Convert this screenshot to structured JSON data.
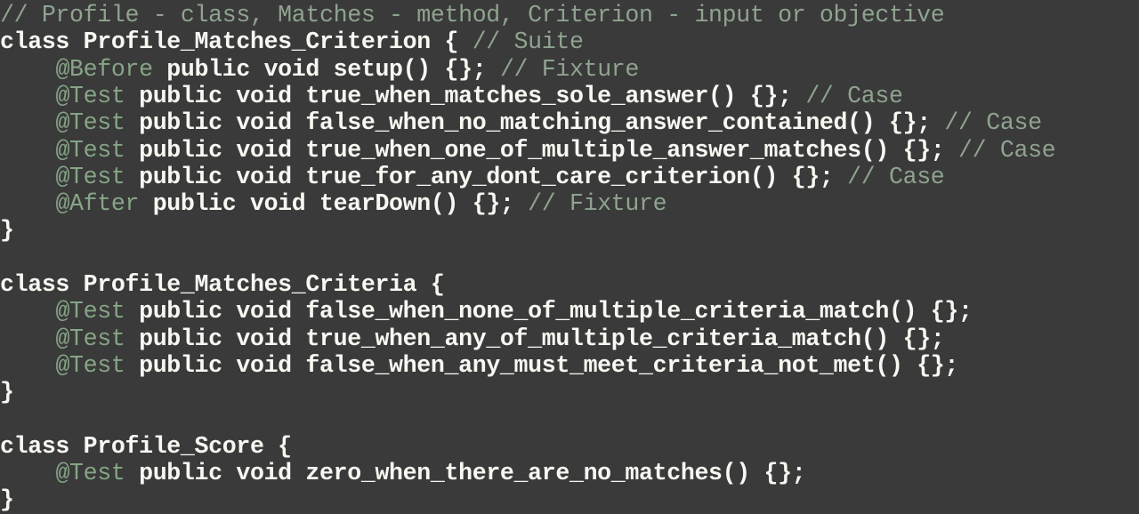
{
  "editor": {
    "colors": {
      "background": "#3a3a3a",
      "text": "#f8f8f2",
      "comment": "#8fa38f",
      "annotation": "#86a586"
    },
    "lines": [
      [
        {
          "t": "// Profile - class, Matches - method, Criterion - input or objective",
          "k": "comment"
        }
      ],
      [
        {
          "t": "class Profile_Matches_Criterion { ",
          "k": "plain"
        },
        {
          "t": "// Suite",
          "k": "comment"
        }
      ],
      [
        {
          "t": "    ",
          "k": "plain"
        },
        {
          "t": "@Before",
          "k": "annotation"
        },
        {
          "t": " public void setup() {}; ",
          "k": "plain"
        },
        {
          "t": "// Fixture",
          "k": "comment"
        }
      ],
      [
        {
          "t": "    ",
          "k": "plain"
        },
        {
          "t": "@Test",
          "k": "annotation"
        },
        {
          "t": " public void true_when_matches_sole_answer() {}; ",
          "k": "plain"
        },
        {
          "t": "// Case",
          "k": "comment"
        }
      ],
      [
        {
          "t": "    ",
          "k": "plain"
        },
        {
          "t": "@Test",
          "k": "annotation"
        },
        {
          "t": " public void false_when_no_matching_answer_contained() {}; ",
          "k": "plain"
        },
        {
          "t": "// Case",
          "k": "comment"
        }
      ],
      [
        {
          "t": "    ",
          "k": "plain"
        },
        {
          "t": "@Test",
          "k": "annotation"
        },
        {
          "t": " public void true_when_one_of_multiple_answer_matches() {}; ",
          "k": "plain"
        },
        {
          "t": "// Case",
          "k": "comment"
        }
      ],
      [
        {
          "t": "    ",
          "k": "plain"
        },
        {
          "t": "@Test",
          "k": "annotation"
        },
        {
          "t": " public void true_for_any_dont_care_criterion() {}; ",
          "k": "plain"
        },
        {
          "t": "// Case",
          "k": "comment"
        }
      ],
      [
        {
          "t": "    ",
          "k": "plain"
        },
        {
          "t": "@After",
          "k": "annotation"
        },
        {
          "t": " public void tearDown() {}; ",
          "k": "plain"
        },
        {
          "t": "// Fixture",
          "k": "comment"
        }
      ],
      [
        {
          "t": "}",
          "k": "plain"
        }
      ],
      [],
      [
        {
          "t": "class Profile_Matches_Criteria {",
          "k": "plain"
        }
      ],
      [
        {
          "t": "    ",
          "k": "plain"
        },
        {
          "t": "@Test",
          "k": "annotation"
        },
        {
          "t": " public void false_when_none_of_multiple_criteria_match() {};",
          "k": "plain"
        }
      ],
      [
        {
          "t": "    ",
          "k": "plain"
        },
        {
          "t": "@Test",
          "k": "annotation"
        },
        {
          "t": " public void true_when_any_of_multiple_criteria_match() {};",
          "k": "plain"
        }
      ],
      [
        {
          "t": "    ",
          "k": "plain"
        },
        {
          "t": "@Test",
          "k": "annotation"
        },
        {
          "t": " public void false_when_any_must_meet_criteria_not_met() {};",
          "k": "plain"
        }
      ],
      [
        {
          "t": "}",
          "k": "plain"
        }
      ],
      [],
      [
        {
          "t": "class Profile_Score {",
          "k": "plain"
        }
      ],
      [
        {
          "t": "    ",
          "k": "plain"
        },
        {
          "t": "@Test",
          "k": "annotation"
        },
        {
          "t": " public void zero_when_there_are_no_matches() {};",
          "k": "plain"
        }
      ],
      [
        {
          "t": "}",
          "k": "plain"
        }
      ]
    ]
  }
}
